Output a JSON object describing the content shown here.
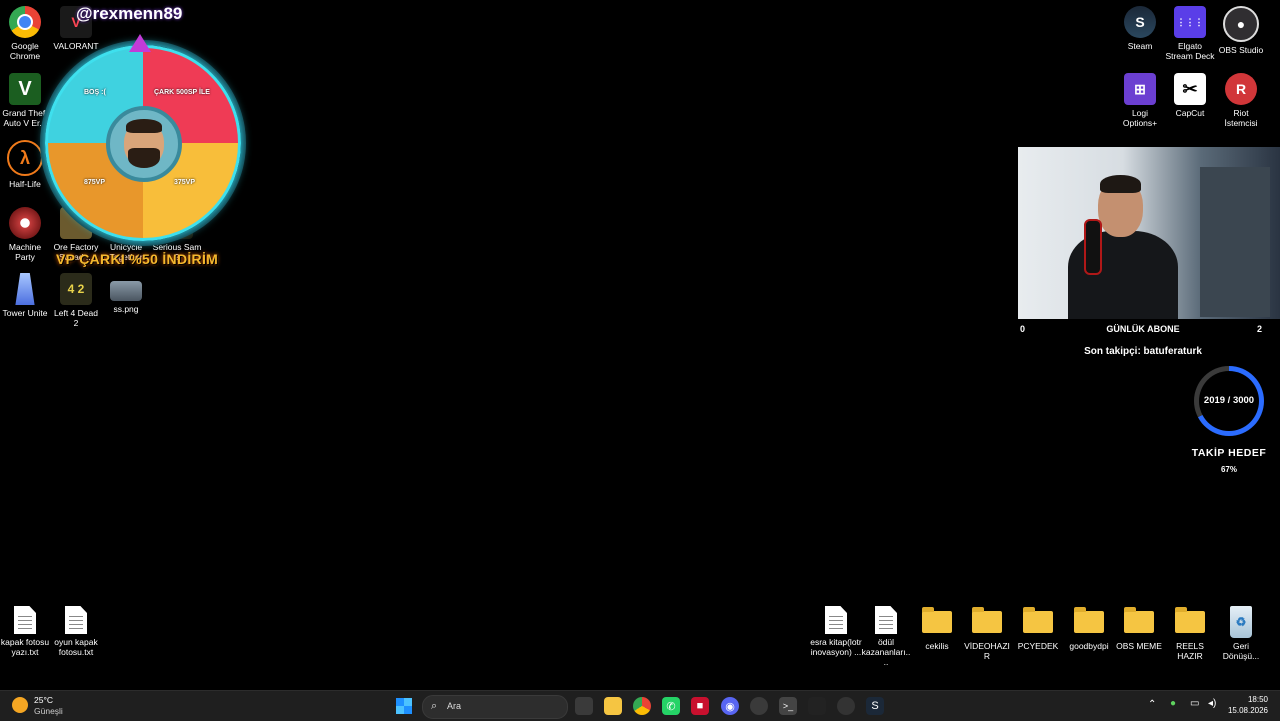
{
  "desktop": {
    "left_icons": [
      {
        "label": "Google Chrome",
        "name": "google-chrome-icon"
      },
      {
        "label": "VALORANT",
        "name": "valorant-icon"
      },
      {
        "label": "Grand Theft Auto V Er...",
        "name": "gta-v-icon"
      },
      {
        "label": "Half-Life",
        "name": "half-life-icon"
      },
      {
        "label": "Machine Party",
        "name": "machine-party-icon"
      },
      {
        "label": "Ore Factory Squad ...",
        "name": "ore-factory-icon"
      },
      {
        "label": "Unicycle Together",
        "name": "unicycle-icon"
      },
      {
        "label": "Serious Sam 2",
        "name": "serious-sam-icon"
      },
      {
        "label": "Tower Unite",
        "name": "tower-unite-icon"
      },
      {
        "label": "Left 4 Dead 2",
        "name": "left4dead-icon"
      },
      {
        "label": "ss.png",
        "name": "image-file-icon"
      },
      {
        "label": "kapak fotosu yazı.txt",
        "name": "text-file-icon"
      },
      {
        "label": "oyun kapak fotosu.txt",
        "name": "text-file-icon"
      }
    ],
    "right_icons": [
      {
        "label": "Steam",
        "name": "steam-icon"
      },
      {
        "label": "Elgato Stream Deck",
        "name": "stream-deck-icon"
      },
      {
        "label": "OBS Studio",
        "name": "obs-studio-icon"
      },
      {
        "label": "Logi Options+",
        "name": "logi-options-icon"
      },
      {
        "label": "CapCut",
        "name": "capcut-icon"
      },
      {
        "label": "Riot İstemcisi",
        "name": "riot-client-icon"
      }
    ],
    "bottom_icons": [
      {
        "label": "esra kitap(lotr inovasyon) ...",
        "name": "chrome-shortcut-icon"
      },
      {
        "label": "ödül kazananları....",
        "name": "text-file-icon"
      },
      {
        "label": "cekilis",
        "name": "folder-icon"
      },
      {
        "label": "VİDEOHAZIR",
        "name": "folder-icon"
      },
      {
        "label": "PCYEDEK",
        "name": "folder-icon"
      },
      {
        "label": "goodbydpi",
        "name": "folder-icon"
      },
      {
        "label": "OBS MEME",
        "name": "folder-icon"
      },
      {
        "label": "REELS HAZIR",
        "name": "folder-icon"
      },
      {
        "label": "Geri Dönüşü...",
        "name": "recycle-bin-icon"
      }
    ]
  },
  "overlay": {
    "username": "@rexmenn89",
    "promo": "VP ÇARKI %50 İNDİRİM",
    "wheel": {
      "seg1": "BOŞ :(",
      "seg2": "ÇARK 500SP İLE",
      "seg3": "875VP",
      "seg4": "375VP"
    },
    "stats": {
      "left_count": "0",
      "title": "GÜNLÜK ABONE",
      "right_count": "2",
      "last_follower": "Son takipçi: batuferaturk"
    },
    "goal": {
      "value_text": "2019 / 3000",
      "current": 2019,
      "target": 3000,
      "title": "TAKİP HEDEF",
      "percent": "67%"
    }
  },
  "taskbar": {
    "weather_temp": "25°C",
    "weather_desc": "Güneşli",
    "search_placeholder": "Ara",
    "time": "18:50",
    "date": "15.08.2026"
  },
  "colors": {
    "wheel_red": "#ef3b55",
    "wheel_yellow": "#f8be3a",
    "wheel_orange": "#e8972b",
    "wheel_cyan": "#3fd2e0",
    "goal_blue": "#2b6cff",
    "promo_orange": "#f5b82e"
  }
}
